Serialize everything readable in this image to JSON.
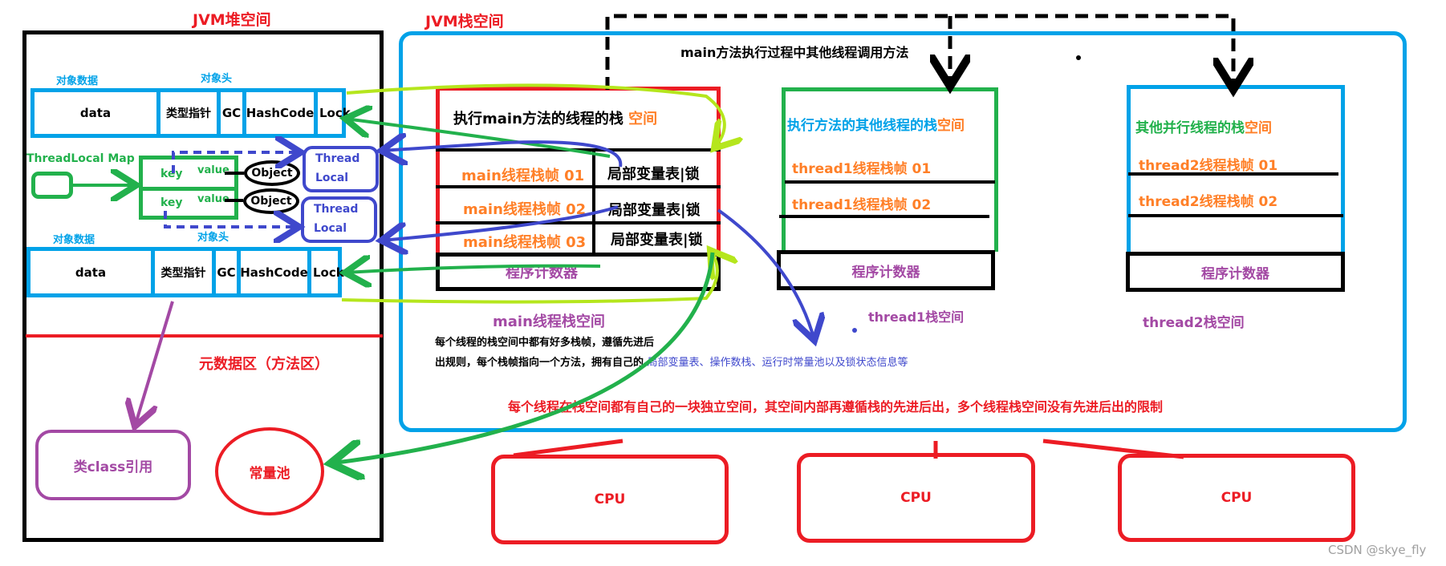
{
  "colors": {
    "red": "#ec1c24",
    "blue": "#00a2e8",
    "orange": "#ff7f27",
    "green": "#22b14c",
    "lime": "#b5e61d",
    "purple": "#a349a4",
    "indigo": "#3f48cc",
    "black": "#000000"
  },
  "heap": {
    "title": "JVM堆空间",
    "objects": [
      {
        "data_label": "对象数据",
        "header_label": "对象头",
        "cells": [
          "data",
          "类型指针",
          "GC",
          "HashCode",
          "Lock"
        ]
      },
      {
        "data_label": "对象数据",
        "header_label": "对象头",
        "cells": [
          "data",
          "类型指针",
          "GC",
          "HashCode",
          "Lock"
        ]
      }
    ],
    "threadlocal_map": {
      "label": "ThreadLocal Map",
      "rows": [
        {
          "key": "key",
          "value": "value",
          "object": "Object"
        },
        {
          "key": "key",
          "value": "value",
          "object": "Object"
        }
      ]
    },
    "threadlocals": [
      {
        "line1": "Thread",
        "line2": "Local"
      },
      {
        "line1": "Thread",
        "line2": "Local"
      }
    ],
    "metaspace": {
      "title": "元数据区（方法区）",
      "class_ref": "类class引用",
      "constant_pool": "常量池"
    }
  },
  "stack": {
    "title": "JVM栈空间",
    "call_note": "main方法执行过程中其他线程调用方法",
    "main": {
      "title_main": "执行main方法的线程的栈 ",
      "title_accent": "空间",
      "frames": [
        {
          "name": "main线程栈帧 01",
          "locals": "局部变量表|锁"
        },
        {
          "name": "main线程栈帧 02",
          "locals": "局部变量表|锁"
        },
        {
          "name": "main线程栈帧 03",
          "locals": "局部变量表|锁"
        }
      ],
      "pc": "程序计数器",
      "caption": "main线程栈空间",
      "desc_line1": "每个线程的栈空间中都有好多栈帧，遵循先进后",
      "desc_line2": "出规则，每个栈帧指向一个方法，拥有自己的 ",
      "desc_line2_accent": "局部变量表、操作数栈、运行时常量池以及锁状态信息等"
    },
    "thread1": {
      "title_main": "执行方法的其他线程的栈",
      "title_accent": "空间",
      "frames": [
        "thread1线程栈帧 01",
        "thread1线程栈帧 02"
      ],
      "pc": "程序计数器",
      "caption": "thread1栈空间"
    },
    "thread2": {
      "title_main": "其他并行线程的栈",
      "title_accent": "空间",
      "frames": [
        "thread2线程栈帧 01",
        "thread2线程栈帧 02"
      ],
      "pc": "程序计数器",
      "caption": "thread2栈空间"
    },
    "summary": "每个线程在栈空间都有自己的一块独立空间，其空间内部再遵循栈的先进后出，多个线程栈空间没有先进后出的限制"
  },
  "cpus": [
    "CPU",
    "CPU",
    "CPU"
  ],
  "watermark": "CSDN @skye_fly"
}
